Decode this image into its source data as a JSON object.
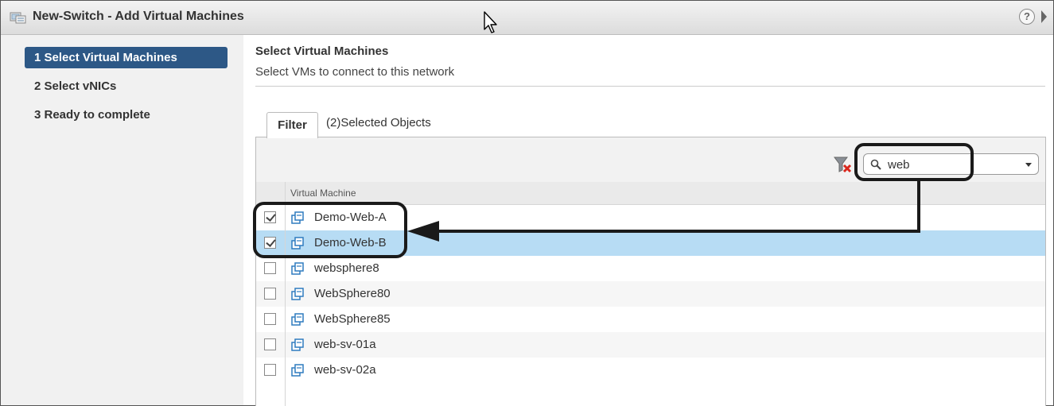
{
  "window": {
    "title": "New-Switch - Add Virtual Machines"
  },
  "nav": {
    "items": [
      {
        "label": "1  Select Virtual Machines",
        "active": true
      },
      {
        "label": "2  Select vNICs",
        "active": false
      },
      {
        "label": "3  Ready to complete",
        "active": false
      }
    ]
  },
  "main": {
    "title": "Select Virtual Machines",
    "subtitle": "Select VMs to connect to this network",
    "tabs": {
      "filter": "Filter",
      "selected": "(2)Selected Objects"
    },
    "search": {
      "value": "web"
    },
    "grid": {
      "column_header": "Virtual Machine",
      "rows": [
        {
          "name": "Demo-Web-A",
          "checked": true,
          "selected": false
        },
        {
          "name": "Demo-Web-B",
          "checked": true,
          "selected": true
        },
        {
          "name": "websphere8",
          "checked": false,
          "selected": false
        },
        {
          "name": "WebSphere80",
          "checked": false,
          "selected": false
        },
        {
          "name": "WebSphere85",
          "checked": false,
          "selected": false
        },
        {
          "name": "web-sv-01a",
          "checked": false,
          "selected": false
        },
        {
          "name": "web-sv-02a",
          "checked": false,
          "selected": false
        }
      ]
    }
  },
  "icons": {
    "title": "switch-wizard-icon",
    "help": "help-icon",
    "collapse": "collapse-arrow-icon",
    "filter_clear": "clear-filter-icon",
    "search": "search-icon",
    "vm": "virtual-machine-icon"
  },
  "colors": {
    "nav_active": "#2d5886",
    "row_selected": "#b7dcf4"
  }
}
